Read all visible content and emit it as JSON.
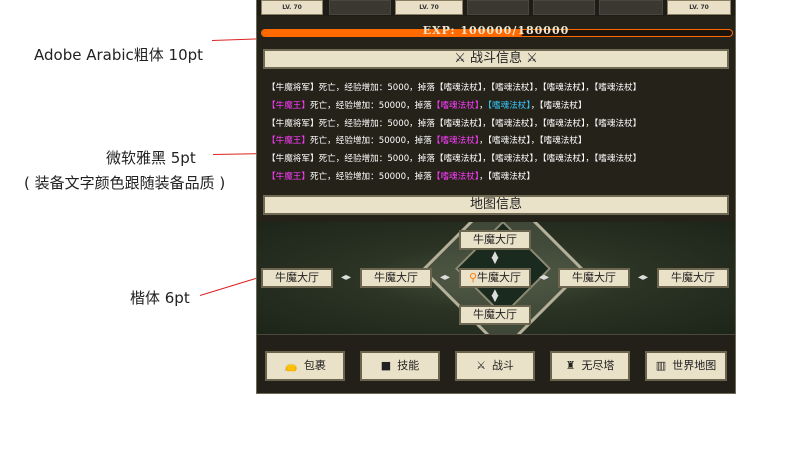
{
  "annotations": {
    "exp_font": "Adobe Arabic粗体 10pt",
    "log_font": "微软雅黑 5pt",
    "log_note": "( 装备文字颜色跟随装备品质 )",
    "map_font": "楷体 6pt"
  },
  "top_strip": {
    "lv_label": "LV. 70"
  },
  "exp": {
    "text": "EXP: 100000/180000",
    "current": 100000,
    "max": 180000,
    "color": "#ff6a00"
  },
  "battle": {
    "title": "战斗信息",
    "logs": [
      {
        "parts": [
          {
            "t": "【牛魔将军】死亡，经验增加：5000，掉落",
            "c": "#ffffff"
          },
          {
            "t": "【嗜魂法杖】",
            "c": "#ffffff"
          },
          {
            "t": "，",
            "c": "#ffffff"
          },
          {
            "t": "【嗜魂法杖】",
            "c": "#ffffff"
          },
          {
            "t": "，",
            "c": "#ffffff"
          },
          {
            "t": "【嗜魂法杖】",
            "c": "#ffffff"
          },
          {
            "t": "，",
            "c": "#ffffff"
          },
          {
            "t": "【嗜魂法杖】",
            "c": "#ffffff"
          }
        ]
      },
      {
        "parts": [
          {
            "t": "【牛魔王】",
            "c": "#ff3cff"
          },
          {
            "t": "死亡，经验增加：50000，掉落",
            "c": "#ffffff"
          },
          {
            "t": "【嗜魂法杖】",
            "c": "#ff3cff"
          },
          {
            "t": "，",
            "c": "#ffffff"
          },
          {
            "t": "【嗜魂法杖】",
            "c": "#33ccff"
          },
          {
            "t": "，",
            "c": "#ffffff"
          },
          {
            "t": "【嗜魂法杖】",
            "c": "#ffffff"
          }
        ]
      },
      {
        "parts": [
          {
            "t": "【牛魔将军】死亡，经验增加：5000，掉落",
            "c": "#ffffff"
          },
          {
            "t": "【嗜魂法杖】",
            "c": "#ffffff"
          },
          {
            "t": "，",
            "c": "#ffffff"
          },
          {
            "t": "【嗜魂法杖】",
            "c": "#ffffff"
          },
          {
            "t": "，",
            "c": "#ffffff"
          },
          {
            "t": "【嗜魂法杖】",
            "c": "#ffffff"
          },
          {
            "t": "，",
            "c": "#ffffff"
          },
          {
            "t": "【嗜魂法杖】",
            "c": "#ffffff"
          }
        ]
      },
      {
        "parts": [
          {
            "t": "【牛魔王】",
            "c": "#ff3cff"
          },
          {
            "t": "死亡，经验增加：50000，掉落",
            "c": "#ffffff"
          },
          {
            "t": "【嗜魂法杖】",
            "c": "#ff3cff"
          },
          {
            "t": "，",
            "c": "#ffffff"
          },
          {
            "t": "【嗜魂法杖】",
            "c": "#ffffff"
          },
          {
            "t": "，",
            "c": "#ffffff"
          },
          {
            "t": "【嗜魂法杖】",
            "c": "#ffffff"
          }
        ]
      },
      {
        "parts": [
          {
            "t": "【牛魔将军】死亡，经验增加：5000，掉落",
            "c": "#ffffff"
          },
          {
            "t": "【嗜魂法杖】",
            "c": "#ffffff"
          },
          {
            "t": "，",
            "c": "#ffffff"
          },
          {
            "t": "【嗜魂法杖】",
            "c": "#ffffff"
          },
          {
            "t": "，",
            "c": "#ffffff"
          },
          {
            "t": "【嗜魂法杖】",
            "c": "#ffffff"
          },
          {
            "t": "，",
            "c": "#ffffff"
          },
          {
            "t": "【嗜魂法杖】",
            "c": "#ffffff"
          }
        ]
      },
      {
        "parts": [
          {
            "t": "【牛魔王】",
            "c": "#ff3cff"
          },
          {
            "t": "死亡，经验增加：50000，掉落",
            "c": "#ffffff"
          },
          {
            "t": "【嗜魂法杖】",
            "c": "#ff3cff"
          },
          {
            "t": "，",
            "c": "#ffffff"
          },
          {
            "t": "【嗜魂法杖】",
            "c": "#ffffff"
          }
        ]
      }
    ]
  },
  "map": {
    "title": "地图信息",
    "node_label": "牛魔大厅"
  },
  "nav": {
    "bag": "包裹",
    "skills": "技能",
    "battle": "战斗",
    "tower": "无尽塔",
    "world_map": "世界地图"
  }
}
